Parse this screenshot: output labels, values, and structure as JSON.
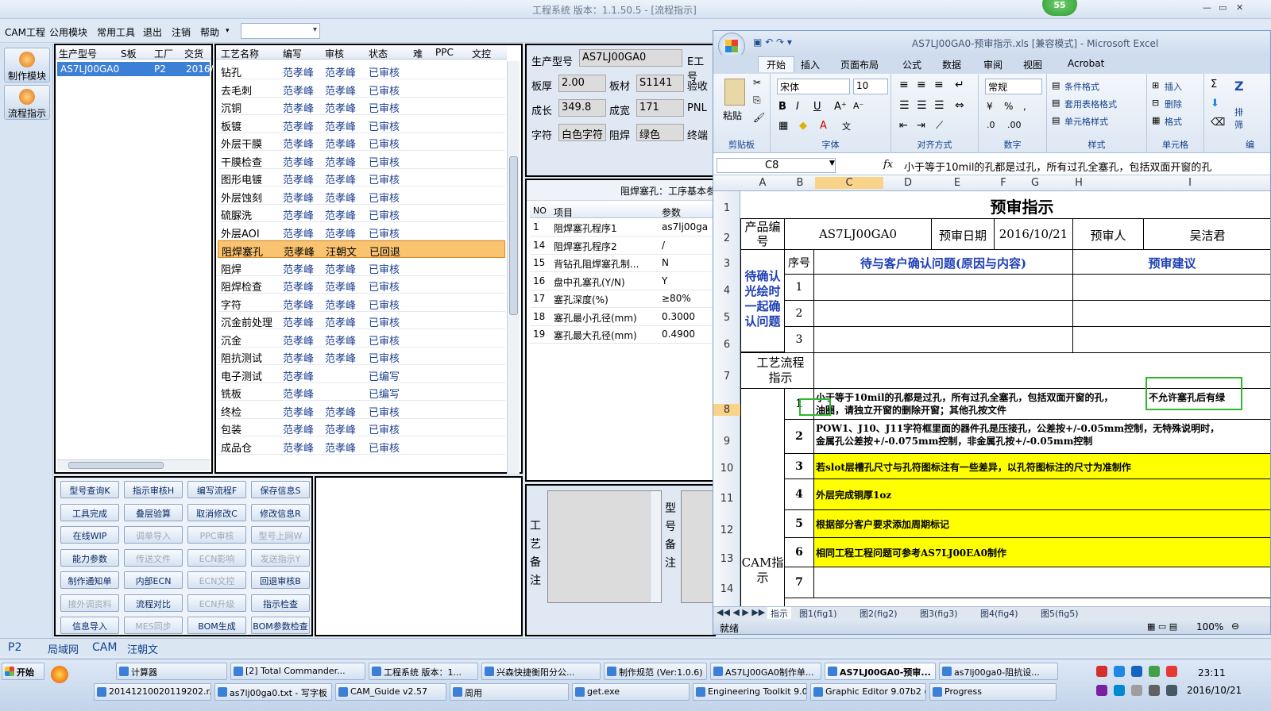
{
  "app": {
    "title": "工程系统   版本：1.1.50.5 - [流程指示]",
    "badge": "55",
    "window_controls": [
      "—",
      "▭",
      "✕"
    ]
  },
  "menu": [
    "CAM工程",
    "公用模块",
    "常用工具",
    "退出",
    "注销",
    "帮助"
  ],
  "left_buttons": [
    "制作模块",
    "流程指示"
  ],
  "model_grid": {
    "headers": [
      "生产型号",
      "S板",
      "工厂",
      "交货日"
    ],
    "row": [
      "AS7LJ00GA0",
      "",
      "P2",
      "2016/"
    ]
  },
  "process_grid": {
    "headers": [
      "工艺名称",
      "编写",
      "审核",
      "状态",
      "难",
      "PPC",
      "文控"
    ],
    "rows": [
      [
        "钻孔",
        "范孝峰",
        "范孝峰",
        "已审核"
      ],
      [
        "去毛刺",
        "范孝峰",
        "范孝峰",
        "已审核"
      ],
      [
        "沉铜",
        "范孝峰",
        "范孝峰",
        "已审核"
      ],
      [
        "板镀",
        "范孝峰",
        "范孝峰",
        "已审核"
      ],
      [
        "外层干膜",
        "范孝峰",
        "范孝峰",
        "已审核"
      ],
      [
        "干膜检查",
        "范孝峰",
        "范孝峰",
        "已审核"
      ],
      [
        "图形电镀",
        "范孝峰",
        "范孝峰",
        "已审核"
      ],
      [
        "外层蚀刻",
        "范孝峰",
        "范孝峰",
        "已审核"
      ],
      [
        "硫脲洗",
        "范孝峰",
        "范孝峰",
        "已审核"
      ],
      [
        "外层AOI",
        "范孝峰",
        "范孝峰",
        "已审核"
      ],
      [
        "阻焊塞孔",
        "范孝峰",
        "汪朝文",
        "已回退"
      ],
      [
        "阻焊",
        "范孝峰",
        "范孝峰",
        "已审核"
      ],
      [
        "阻焊检查",
        "范孝峰",
        "范孝峰",
        "已审核"
      ],
      [
        "字符",
        "范孝峰",
        "范孝峰",
        "已审核"
      ],
      [
        "沉金前处理",
        "范孝峰",
        "范孝峰",
        "已审核"
      ],
      [
        "沉金",
        "范孝峰",
        "范孝峰",
        "已审核"
      ],
      [
        "阻抗测试",
        "范孝峰",
        "范孝峰",
        "已审核"
      ],
      [
        "电子测试",
        "范孝峰",
        "",
        "已编写"
      ],
      [
        "铣板",
        "范孝峰",
        "",
        "已编写"
      ],
      [
        "终检",
        "范孝峰",
        "范孝峰",
        "已审核"
      ],
      [
        "包装",
        "范孝峰",
        "范孝峰",
        "已审核"
      ],
      [
        "成品仓",
        "范孝峰",
        "范孝峰",
        "已审核"
      ]
    ],
    "selected_index": 10
  },
  "action_buttons": [
    {
      "label": "型号查询K",
      "enabled": true
    },
    {
      "label": "指示审核H",
      "enabled": true
    },
    {
      "label": "编写流程F",
      "enabled": true
    },
    {
      "label": "保存信息S",
      "enabled": true
    },
    {
      "label": "工具完成",
      "enabled": true
    },
    {
      "label": "叠层验算",
      "enabled": true
    },
    {
      "label": "取消修改C",
      "enabled": true
    },
    {
      "label": "修改信息R",
      "enabled": true
    },
    {
      "label": "在线WIP",
      "enabled": true
    },
    {
      "label": "调单导入",
      "enabled": false
    },
    {
      "label": "PPC审核",
      "enabled": false
    },
    {
      "label": "型号上网W",
      "enabled": false
    },
    {
      "label": "能力参数",
      "enabled": true
    },
    {
      "label": "传送文件",
      "enabled": false
    },
    {
      "label": "ECN影响",
      "enabled": false
    },
    {
      "label": "发送指示Y",
      "enabled": false
    },
    {
      "label": "制作通知单",
      "enabled": true
    },
    {
      "label": "内部ECN",
      "enabled": true
    },
    {
      "label": "ECN文控",
      "enabled": false
    },
    {
      "label": "回退审核B",
      "enabled": true
    },
    {
      "label": "接外调资料",
      "enabled": false
    },
    {
      "label": "流程对比",
      "enabled": true
    },
    {
      "label": "ECN升级",
      "enabled": false
    },
    {
      "label": "指示检查",
      "enabled": true
    },
    {
      "label": "信息导入",
      "enabled": true
    },
    {
      "label": "MES同步",
      "enabled": false
    },
    {
      "label": "BOM生成",
      "enabled": true
    },
    {
      "label": "BOM参数检查",
      "enabled": true
    }
  ],
  "info": {
    "model_label": "生产型号",
    "model_value": "AS7LJ00GA0",
    "ecode_label": "E工号",
    "thickness_label": "板厚",
    "thickness_value": "2.00",
    "material_label": "板材",
    "material_value": "S1141",
    "inspect_label": "验收",
    "length_label": "成长",
    "length_value": "349.8",
    "width_label": "成宽",
    "width_value": "171",
    "pnl_label": "PNL",
    "char_label": "字符",
    "char_value": "白色字符",
    "mask_label": "阻焊",
    "mask_value": "绿色",
    "final_label": "终端"
  },
  "params": {
    "title": "阻焊塞孔：工序基本参",
    "headers": [
      "NO",
      "项目",
      "参数"
    ],
    "rows": [
      [
        "1",
        "阻焊塞孔程序1",
        "as7lj00ga"
      ],
      [
        "14",
        "阻焊塞孔程序2",
        "/"
      ],
      [
        "15",
        "背钻孔阻焊塞孔制...",
        "N"
      ],
      [
        "16",
        "盘中孔塞孔(Y/N)",
        "Y"
      ],
      [
        "17",
        "塞孔深度(%)",
        "≥80%"
      ],
      [
        "18",
        "塞孔最小孔径(mm)",
        "0.3000"
      ],
      [
        "19",
        "塞孔最大孔径(mm)",
        "0.4900"
      ]
    ]
  },
  "remarks": {
    "process_remark": "工艺备注",
    "model_remark": "型号备注"
  },
  "excel": {
    "title": "AS7LJ00GA0-预审指示.xls  [兼容模式] - Microsoft Excel",
    "tabs": [
      "开始",
      "插入",
      "页面布局",
      "公式",
      "数据",
      "审阅",
      "视图",
      "Acrobat"
    ],
    "groups": [
      "剪贴板",
      "字体",
      "对齐方式",
      "数字",
      "样式",
      "单元格",
      "编"
    ],
    "paste": "粘贴",
    "font_name": "宋体",
    "font_size": "10",
    "number_format": "常规",
    "style_items": [
      "条件格式",
      "套用表格格式",
      "单元格样式"
    ],
    "cell_items": [
      "插入",
      "删除",
      "格式"
    ],
    "sort_items": [
      "排",
      "筛"
    ],
    "name_box": "C8",
    "fx": "fx",
    "formula": "小于等于10mil的孔都是过孔，所有过孔全塞孔，包括双面开窗的孔",
    "columns": [
      "A",
      "B",
      "C",
      "D",
      "E",
      "F",
      "G",
      "H",
      "I"
    ],
    "rows": [
      "1",
      "2",
      "3",
      "4",
      "5",
      "6",
      "7",
      "8",
      "9",
      "10",
      "11",
      "12",
      "13",
      "14"
    ],
    "sheet": {
      "title": "预审指示",
      "product_label": "产品编号",
      "product_value": "AS7LJ00GA0",
      "date_label": "预审日期",
      "date_value": "2016/10/21",
      "reviewer_label": "预审人",
      "reviewer_value": "吴洁君",
      "seq_label": "序号",
      "issue_header": "待与客户确认问题(原因与内容)",
      "suggest_header": "预审建议",
      "confirm_label": "待确认光绘时一起确认问题",
      "seq": [
        "1",
        "2",
        "3"
      ],
      "flow_label": "工艺流程指示",
      "cam_label": "CAM指示",
      "cam_rows": [
        {
          "no": "1",
          "text": "小于等于10mil的孔都是过孔，所有过孔全塞孔，包括双面开窗的孔，",
          "text2": "油圈，请独立开窗的删除开窗；其他孔按文件",
          "tail": "不允许塞孔后有绿"
        },
        {
          "no": "2",
          "text": "POW1、J10、J11字符框里面的器件孔是压接孔，公差按+/-0.05mm控制，无特殊说明时，",
          "text2": "金属孔公差按+/-0.075mm控制，非金属孔按+/-0.05mm控制"
        },
        {
          "no": "3",
          "text": "若slot层槽孔尺寸与孔符图标注有一些差异，以孔符图标注的尺寸为准制作"
        },
        {
          "no": "4",
          "text": "外层完成铜厚1oz"
        },
        {
          "no": "5",
          "text": "根据部分客户要求添加周期标记"
        },
        {
          "no": "6",
          "text": "相同工程工程问题可参考AS7LJ00EA0制作"
        },
        {
          "no": "7",
          "text": ""
        }
      ]
    },
    "sheet_tabs": [
      "指示",
      "图1(fig1)",
      "图2(fig2)",
      "图3(fig3)",
      "图4(fig4)",
      "图5(fig5)"
    ],
    "status": "就绪",
    "zoom": "100%"
  },
  "app_tabs": [
    "P2",
    "局域网",
    "CAM",
    "汪朝文"
  ],
  "taskbar": {
    "start": "开始",
    "row1": [
      "计算器",
      "[2] Total Commander...",
      "工程系统  版本：1...",
      "兴森快捷衡阳分公...",
      "制作规范 (Ver:1.0.6)",
      "AS7LJ00GA0制作单...",
      "AS7LJ00GA0-预审...",
      "as7lj00ga0-阻抗设..."
    ],
    "row2": [
      "20141210020119202.r...",
      "as7lj00ga0.txt - 写字板",
      "CAM_Guide v2.57",
      "周用",
      "get.exe",
      "Engineering Toolkit 9.0...",
      "Graphic Editor 9.07b2 (...",
      "Progress"
    ],
    "time": "23:11",
    "date": "2016/10/21"
  },
  "colors": {
    "accent": "#3b7fd6",
    "selected_row": "#f9c370",
    "yellow": "#ffff00",
    "header_blue": "#1f3fb5"
  }
}
